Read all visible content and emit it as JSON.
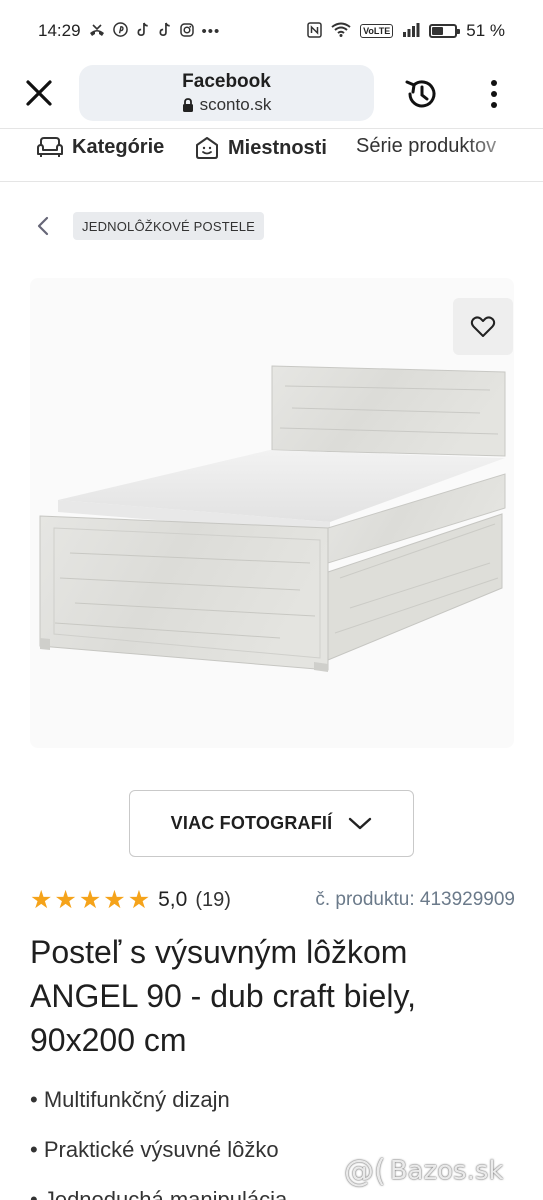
{
  "status_bar": {
    "time": "14:29",
    "battery_percent": "51 %",
    "battery_level": 0.51,
    "left_icons": [
      "missed-call-icon",
      "pinterest-icon",
      "tiktok-icon",
      "tiktok-icon",
      "instagram-icon",
      "more-dots-icon"
    ],
    "right_icons": [
      "nfc-icon",
      "wifi-icon",
      "volte-icon",
      "signal-icon",
      "battery-icon"
    ],
    "volte_label": "VoLTE"
  },
  "browser": {
    "page_title": "Facebook",
    "host": "sconto.sk"
  },
  "category_nav": {
    "items": [
      {
        "label": "Kategórie",
        "icon": "sofa-icon"
      },
      {
        "label": "Miestnosti",
        "icon": "room-icon"
      },
      {
        "label": "Série produktov",
        "icon": ""
      }
    ]
  },
  "breadcrumb": {
    "label": "JEDNOLÔŽKOVÉ POSTELE"
  },
  "product": {
    "more_photos_label": "VIAC FOTOGRAFIÍ",
    "rating": 5,
    "rating_value": "5,0",
    "rating_count": "(19)",
    "product_number": "č. produktu: 413929909",
    "title": "Posteľ s výsuvným lôžkom ANGEL 90 - dub craft biely, 90x200 cm",
    "features": [
      "Multifunkčný dizajn",
      "Praktické výsuvné lôžko",
      "Jednoduchá manipulácia"
    ]
  },
  "watermark": {
    "text": "Bazos.sk"
  },
  "colors": {
    "star": "#f5a31a",
    "product_number": "#6b7a8a",
    "url_box": "#edf0f4"
  }
}
